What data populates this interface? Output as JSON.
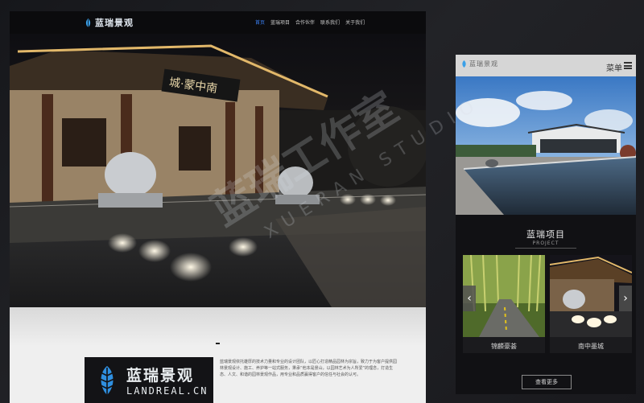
{
  "desktop": {
    "logo_text": "蓝瑞景观",
    "nav": [
      {
        "label": "首页",
        "active": true
      },
      {
        "label": "蓝瑞项目",
        "active": false
      },
      {
        "label": "合作伙伴",
        "active": false
      },
      {
        "label": "联系我们",
        "active": false
      },
      {
        "label": "关于我们",
        "active": false
      }
    ],
    "hero": {
      "sign_text": "城·蒙中南"
    },
    "about": {
      "brand_cn": "蓝瑞景观",
      "brand_domain": "LANDREAL.CN",
      "text": "蓝瑞景观依托雄厚的技术力量和专业的设计团队，以匠心打造精品园林为宗旨，致力于为客户提供园林景观设计、施工、养护等一站式服务，秉承“他本是景山，以园林艺术为人所爱”的理念，打造生态、人文、和谐的园林景观作品，用专业和品质赢得客户的信任与社会的认可。"
    }
  },
  "mobile": {
    "logo_text": "蓝瑞景观",
    "menu_label": "菜单",
    "section_title": "蓝瑞项目",
    "section_subtitle": "PROJECT",
    "projects": [
      {
        "caption": "锦麟豪荟"
      },
      {
        "caption": "南中墨城"
      }
    ],
    "prev_arrow": "‹",
    "next_arrow": "›",
    "more_button": "查看更多"
  },
  "watermark": {
    "cn": "蓝瑞工作室",
    "en": "XUERAN STUDIO"
  },
  "colors": {
    "accent": "#3b82f6",
    "background": "#1d1e22",
    "nav_dark": "#0b0b0d"
  }
}
